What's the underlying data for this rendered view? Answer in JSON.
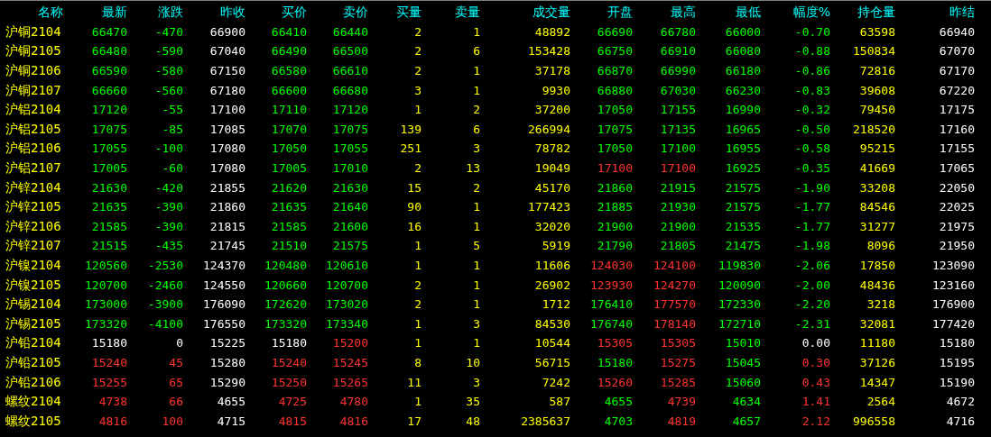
{
  "table": {
    "name_column": "名称",
    "columns": [
      "最新",
      "涨跌",
      "昨收",
      "买价",
      "卖价",
      "买量",
      "卖量",
      "成交量",
      "开盘",
      "最高",
      "最低",
      "幅度%",
      "持仓量",
      "昨结"
    ],
    "rows": [
      {
        "name": "沪铜2104",
        "cells": [
          {
            "text": "66470",
            "color": "#00ff00"
          },
          {
            "text": "-470",
            "color": "#00ff00"
          },
          {
            "text": "66900",
            "color": "#ffffff"
          },
          {
            "text": "66410",
            "color": "#00ff00"
          },
          {
            "text": "66440",
            "color": "#00ff00"
          },
          {
            "text": "2",
            "color": "#ffff00"
          },
          {
            "text": "1",
            "color": "#ffff00"
          },
          {
            "text": "48892",
            "color": "#ffff00"
          },
          {
            "text": "66690",
            "color": "#00ff00"
          },
          {
            "text": "66780",
            "color": "#00ff00"
          },
          {
            "text": "66000",
            "color": "#00ff00"
          },
          {
            "text": "-0.70",
            "color": "#00ff00"
          },
          {
            "text": "63598",
            "color": "#ffff00"
          },
          {
            "text": "66940",
            "color": "#ffffff"
          }
        ]
      },
      {
        "name": "沪铜2105",
        "cells": [
          {
            "text": "66480",
            "color": "#00ff00"
          },
          {
            "text": "-590",
            "color": "#00ff00"
          },
          {
            "text": "67040",
            "color": "#ffffff"
          },
          {
            "text": "66490",
            "color": "#00ff00"
          },
          {
            "text": "66500",
            "color": "#00ff00"
          },
          {
            "text": "2",
            "color": "#ffff00"
          },
          {
            "text": "6",
            "color": "#ffff00"
          },
          {
            "text": "153428",
            "color": "#ffff00"
          },
          {
            "text": "66750",
            "color": "#00ff00"
          },
          {
            "text": "66910",
            "color": "#00ff00"
          },
          {
            "text": "66080",
            "color": "#00ff00"
          },
          {
            "text": "-0.88",
            "color": "#00ff00"
          },
          {
            "text": "150834",
            "color": "#ffff00"
          },
          {
            "text": "67070",
            "color": "#ffffff"
          }
        ]
      },
      {
        "name": "沪铜2106",
        "cells": [
          {
            "text": "66590",
            "color": "#00ff00"
          },
          {
            "text": "-580",
            "color": "#00ff00"
          },
          {
            "text": "67150",
            "color": "#ffffff"
          },
          {
            "text": "66580",
            "color": "#00ff00"
          },
          {
            "text": "66610",
            "color": "#00ff00"
          },
          {
            "text": "2",
            "color": "#ffff00"
          },
          {
            "text": "1",
            "color": "#ffff00"
          },
          {
            "text": "37178",
            "color": "#ffff00"
          },
          {
            "text": "66870",
            "color": "#00ff00"
          },
          {
            "text": "66990",
            "color": "#00ff00"
          },
          {
            "text": "66180",
            "color": "#00ff00"
          },
          {
            "text": "-0.86",
            "color": "#00ff00"
          },
          {
            "text": "72816",
            "color": "#ffff00"
          },
          {
            "text": "67170",
            "color": "#ffffff"
          }
        ]
      },
      {
        "name": "沪铜2107",
        "cells": [
          {
            "text": "66660",
            "color": "#00ff00"
          },
          {
            "text": "-560",
            "color": "#00ff00"
          },
          {
            "text": "67180",
            "color": "#ffffff"
          },
          {
            "text": "66600",
            "color": "#00ff00"
          },
          {
            "text": "66680",
            "color": "#00ff00"
          },
          {
            "text": "3",
            "color": "#ffff00"
          },
          {
            "text": "1",
            "color": "#ffff00"
          },
          {
            "text": "9930",
            "color": "#ffff00"
          },
          {
            "text": "66880",
            "color": "#00ff00"
          },
          {
            "text": "67030",
            "color": "#00ff00"
          },
          {
            "text": "66230",
            "color": "#00ff00"
          },
          {
            "text": "-0.83",
            "color": "#00ff00"
          },
          {
            "text": "39608",
            "color": "#ffff00"
          },
          {
            "text": "67220",
            "color": "#ffffff"
          }
        ]
      },
      {
        "name": "沪铝2104",
        "cells": [
          {
            "text": "17120",
            "color": "#00ff00"
          },
          {
            "text": "-55",
            "color": "#00ff00"
          },
          {
            "text": "17100",
            "color": "#ffffff"
          },
          {
            "text": "17110",
            "color": "#00ff00"
          },
          {
            "text": "17120",
            "color": "#00ff00"
          },
          {
            "text": "1",
            "color": "#ffff00"
          },
          {
            "text": "2",
            "color": "#ffff00"
          },
          {
            "text": "37200",
            "color": "#ffff00"
          },
          {
            "text": "17050",
            "color": "#00ff00"
          },
          {
            "text": "17155",
            "color": "#00ff00"
          },
          {
            "text": "16990",
            "color": "#00ff00"
          },
          {
            "text": "-0.32",
            "color": "#00ff00"
          },
          {
            "text": "79450",
            "color": "#ffff00"
          },
          {
            "text": "17175",
            "color": "#ffffff"
          }
        ]
      },
      {
        "name": "沪铝2105",
        "cells": [
          {
            "text": "17075",
            "color": "#00ff00"
          },
          {
            "text": "-85",
            "color": "#00ff00"
          },
          {
            "text": "17085",
            "color": "#ffffff"
          },
          {
            "text": "17070",
            "color": "#00ff00"
          },
          {
            "text": "17075",
            "color": "#00ff00"
          },
          {
            "text": "139",
            "color": "#ffff00"
          },
          {
            "text": "6",
            "color": "#ffff00"
          },
          {
            "text": "266994",
            "color": "#ffff00"
          },
          {
            "text": "17075",
            "color": "#00ff00"
          },
          {
            "text": "17135",
            "color": "#00ff00"
          },
          {
            "text": "16965",
            "color": "#00ff00"
          },
          {
            "text": "-0.50",
            "color": "#00ff00"
          },
          {
            "text": "218520",
            "color": "#ffff00"
          },
          {
            "text": "17160",
            "color": "#ffffff"
          }
        ]
      },
      {
        "name": "沪铝2106",
        "cells": [
          {
            "text": "17055",
            "color": "#00ff00"
          },
          {
            "text": "-100",
            "color": "#00ff00"
          },
          {
            "text": "17080",
            "color": "#ffffff"
          },
          {
            "text": "17050",
            "color": "#00ff00"
          },
          {
            "text": "17055",
            "color": "#00ff00"
          },
          {
            "text": "251",
            "color": "#ffff00"
          },
          {
            "text": "3",
            "color": "#ffff00"
          },
          {
            "text": "78782",
            "color": "#ffff00"
          },
          {
            "text": "17050",
            "color": "#00ff00"
          },
          {
            "text": "17100",
            "color": "#00ff00"
          },
          {
            "text": "16955",
            "color": "#00ff00"
          },
          {
            "text": "-0.58",
            "color": "#00ff00"
          },
          {
            "text": "95215",
            "color": "#ffff00"
          },
          {
            "text": "17155",
            "color": "#ffffff"
          }
        ]
      },
      {
        "name": "沪铝2107",
        "cells": [
          {
            "text": "17005",
            "color": "#00ff00"
          },
          {
            "text": "-60",
            "color": "#00ff00"
          },
          {
            "text": "17080",
            "color": "#ffffff"
          },
          {
            "text": "17005",
            "color": "#00ff00"
          },
          {
            "text": "17010",
            "color": "#00ff00"
          },
          {
            "text": "2",
            "color": "#ffff00"
          },
          {
            "text": "13",
            "color": "#ffff00"
          },
          {
            "text": "19049",
            "color": "#ffff00"
          },
          {
            "text": "17100",
            "color": "#ff3232"
          },
          {
            "text": "17100",
            "color": "#ff3232"
          },
          {
            "text": "16925",
            "color": "#00ff00"
          },
          {
            "text": "-0.35",
            "color": "#00ff00"
          },
          {
            "text": "41669",
            "color": "#ffff00"
          },
          {
            "text": "17065",
            "color": "#ffffff"
          }
        ]
      },
      {
        "name": "沪锌2104",
        "cells": [
          {
            "text": "21630",
            "color": "#00ff00"
          },
          {
            "text": "-420",
            "color": "#00ff00"
          },
          {
            "text": "21855",
            "color": "#ffffff"
          },
          {
            "text": "21620",
            "color": "#00ff00"
          },
          {
            "text": "21630",
            "color": "#00ff00"
          },
          {
            "text": "15",
            "color": "#ffff00"
          },
          {
            "text": "2",
            "color": "#ffff00"
          },
          {
            "text": "45170",
            "color": "#ffff00"
          },
          {
            "text": "21860",
            "color": "#00ff00"
          },
          {
            "text": "21915",
            "color": "#00ff00"
          },
          {
            "text": "21575",
            "color": "#00ff00"
          },
          {
            "text": "-1.90",
            "color": "#00ff00"
          },
          {
            "text": "33208",
            "color": "#ffff00"
          },
          {
            "text": "22050",
            "color": "#ffffff"
          }
        ]
      },
      {
        "name": "沪锌2105",
        "cells": [
          {
            "text": "21635",
            "color": "#00ff00"
          },
          {
            "text": "-390",
            "color": "#00ff00"
          },
          {
            "text": "21860",
            "color": "#ffffff"
          },
          {
            "text": "21635",
            "color": "#00ff00"
          },
          {
            "text": "21640",
            "color": "#00ff00"
          },
          {
            "text": "90",
            "color": "#ffff00"
          },
          {
            "text": "1",
            "color": "#ffff00"
          },
          {
            "text": "177423",
            "color": "#ffff00"
          },
          {
            "text": "21885",
            "color": "#00ff00"
          },
          {
            "text": "21930",
            "color": "#00ff00"
          },
          {
            "text": "21575",
            "color": "#00ff00"
          },
          {
            "text": "-1.77",
            "color": "#00ff00"
          },
          {
            "text": "84546",
            "color": "#ffff00"
          },
          {
            "text": "22025",
            "color": "#ffffff"
          }
        ]
      },
      {
        "name": "沪锌2106",
        "cells": [
          {
            "text": "21585",
            "color": "#00ff00"
          },
          {
            "text": "-390",
            "color": "#00ff00"
          },
          {
            "text": "21815",
            "color": "#ffffff"
          },
          {
            "text": "21585",
            "color": "#00ff00"
          },
          {
            "text": "21600",
            "color": "#00ff00"
          },
          {
            "text": "16",
            "color": "#ffff00"
          },
          {
            "text": "1",
            "color": "#ffff00"
          },
          {
            "text": "32020",
            "color": "#ffff00"
          },
          {
            "text": "21900",
            "color": "#00ff00"
          },
          {
            "text": "21900",
            "color": "#00ff00"
          },
          {
            "text": "21535",
            "color": "#00ff00"
          },
          {
            "text": "-1.77",
            "color": "#00ff00"
          },
          {
            "text": "31277",
            "color": "#ffff00"
          },
          {
            "text": "21975",
            "color": "#ffffff"
          }
        ]
      },
      {
        "name": "沪锌2107",
        "cells": [
          {
            "text": "21515",
            "color": "#00ff00"
          },
          {
            "text": "-435",
            "color": "#00ff00"
          },
          {
            "text": "21745",
            "color": "#ffffff"
          },
          {
            "text": "21510",
            "color": "#00ff00"
          },
          {
            "text": "21575",
            "color": "#00ff00"
          },
          {
            "text": "1",
            "color": "#ffff00"
          },
          {
            "text": "5",
            "color": "#ffff00"
          },
          {
            "text": "5919",
            "color": "#ffff00"
          },
          {
            "text": "21790",
            "color": "#00ff00"
          },
          {
            "text": "21805",
            "color": "#00ff00"
          },
          {
            "text": "21475",
            "color": "#00ff00"
          },
          {
            "text": "-1.98",
            "color": "#00ff00"
          },
          {
            "text": "8096",
            "color": "#ffff00"
          },
          {
            "text": "21950",
            "color": "#ffffff"
          }
        ]
      },
      {
        "name": "沪镍2104",
        "cells": [
          {
            "text": "120560",
            "color": "#00ff00"
          },
          {
            "text": "-2530",
            "color": "#00ff00"
          },
          {
            "text": "124370",
            "color": "#ffffff"
          },
          {
            "text": "120480",
            "color": "#00ff00"
          },
          {
            "text": "120610",
            "color": "#00ff00"
          },
          {
            "text": "1",
            "color": "#ffff00"
          },
          {
            "text": "1",
            "color": "#ffff00"
          },
          {
            "text": "11606",
            "color": "#ffff00"
          },
          {
            "text": "124030",
            "color": "#ff3232"
          },
          {
            "text": "124100",
            "color": "#ff3232"
          },
          {
            "text": "119830",
            "color": "#00ff00"
          },
          {
            "text": "-2.06",
            "color": "#00ff00"
          },
          {
            "text": "17850",
            "color": "#ffff00"
          },
          {
            "text": "123090",
            "color": "#ffffff"
          }
        ]
      },
      {
        "name": "沪镍2105",
        "cells": [
          {
            "text": "120700",
            "color": "#00ff00"
          },
          {
            "text": "-2460",
            "color": "#00ff00"
          },
          {
            "text": "124550",
            "color": "#ffffff"
          },
          {
            "text": "120660",
            "color": "#00ff00"
          },
          {
            "text": "120700",
            "color": "#00ff00"
          },
          {
            "text": "2",
            "color": "#ffff00"
          },
          {
            "text": "1",
            "color": "#ffff00"
          },
          {
            "text": "26902",
            "color": "#ffff00"
          },
          {
            "text": "123930",
            "color": "#ff3232"
          },
          {
            "text": "124270",
            "color": "#ff3232"
          },
          {
            "text": "120090",
            "color": "#00ff00"
          },
          {
            "text": "-2.00",
            "color": "#00ff00"
          },
          {
            "text": "48436",
            "color": "#ffff00"
          },
          {
            "text": "123160",
            "color": "#ffffff"
          }
        ]
      },
      {
        "name": "沪锡2104",
        "cells": [
          {
            "text": "173000",
            "color": "#00ff00"
          },
          {
            "text": "-3900",
            "color": "#00ff00"
          },
          {
            "text": "176090",
            "color": "#ffffff"
          },
          {
            "text": "172620",
            "color": "#00ff00"
          },
          {
            "text": "173020",
            "color": "#00ff00"
          },
          {
            "text": "2",
            "color": "#ffff00"
          },
          {
            "text": "1",
            "color": "#ffff00"
          },
          {
            "text": "1712",
            "color": "#ffff00"
          },
          {
            "text": "176410",
            "color": "#00ff00"
          },
          {
            "text": "177570",
            "color": "#ff3232"
          },
          {
            "text": "172330",
            "color": "#00ff00"
          },
          {
            "text": "-2.20",
            "color": "#00ff00"
          },
          {
            "text": "3218",
            "color": "#ffff00"
          },
          {
            "text": "176900",
            "color": "#ffffff"
          }
        ]
      },
      {
        "name": "沪锡2105",
        "cells": [
          {
            "text": "173320",
            "color": "#00ff00"
          },
          {
            "text": "-4100",
            "color": "#00ff00"
          },
          {
            "text": "176550",
            "color": "#ffffff"
          },
          {
            "text": "173320",
            "color": "#00ff00"
          },
          {
            "text": "173340",
            "color": "#00ff00"
          },
          {
            "text": "1",
            "color": "#ffff00"
          },
          {
            "text": "3",
            "color": "#ffff00"
          },
          {
            "text": "84530",
            "color": "#ffff00"
          },
          {
            "text": "176740",
            "color": "#00ff00"
          },
          {
            "text": "178140",
            "color": "#ff3232"
          },
          {
            "text": "172710",
            "color": "#00ff00"
          },
          {
            "text": "-2.31",
            "color": "#00ff00"
          },
          {
            "text": "32081",
            "color": "#ffff00"
          },
          {
            "text": "177420",
            "color": "#ffffff"
          }
        ]
      },
      {
        "name": "沪铅2104",
        "cells": [
          {
            "text": "15180",
            "color": "#ffffff"
          },
          {
            "text": "0",
            "color": "#ffffff"
          },
          {
            "text": "15225",
            "color": "#ffffff"
          },
          {
            "text": "15180",
            "color": "#ffffff"
          },
          {
            "text": "15200",
            "color": "#ff3232"
          },
          {
            "text": "1",
            "color": "#ffff00"
          },
          {
            "text": "1",
            "color": "#ffff00"
          },
          {
            "text": "10544",
            "color": "#ffff00"
          },
          {
            "text": "15305",
            "color": "#ff3232"
          },
          {
            "text": "15305",
            "color": "#ff3232"
          },
          {
            "text": "15010",
            "color": "#00ff00"
          },
          {
            "text": "0.00",
            "color": "#ffffff"
          },
          {
            "text": "11180",
            "color": "#ffff00"
          },
          {
            "text": "15180",
            "color": "#ffffff"
          }
        ]
      },
      {
        "name": "沪铅2105",
        "cells": [
          {
            "text": "15240",
            "color": "#ff3232"
          },
          {
            "text": "45",
            "color": "#ff3232"
          },
          {
            "text": "15280",
            "color": "#ffffff"
          },
          {
            "text": "15240",
            "color": "#ff3232"
          },
          {
            "text": "15245",
            "color": "#ff3232"
          },
          {
            "text": "8",
            "color": "#ffff00"
          },
          {
            "text": "10",
            "color": "#ffff00"
          },
          {
            "text": "56715",
            "color": "#ffff00"
          },
          {
            "text": "15180",
            "color": "#00ff00"
          },
          {
            "text": "15275",
            "color": "#ff3232"
          },
          {
            "text": "15045",
            "color": "#00ff00"
          },
          {
            "text": "0.30",
            "color": "#ff3232"
          },
          {
            "text": "37126",
            "color": "#ffff00"
          },
          {
            "text": "15195",
            "color": "#ffffff"
          }
        ]
      },
      {
        "name": "沪铅2106",
        "cells": [
          {
            "text": "15255",
            "color": "#ff3232"
          },
          {
            "text": "65",
            "color": "#ff3232"
          },
          {
            "text": "15290",
            "color": "#ffffff"
          },
          {
            "text": "15250",
            "color": "#ff3232"
          },
          {
            "text": "15265",
            "color": "#ff3232"
          },
          {
            "text": "11",
            "color": "#ffff00"
          },
          {
            "text": "3",
            "color": "#ffff00"
          },
          {
            "text": "7242",
            "color": "#ffff00"
          },
          {
            "text": "15260",
            "color": "#ff3232"
          },
          {
            "text": "15285",
            "color": "#ff3232"
          },
          {
            "text": "15060",
            "color": "#00ff00"
          },
          {
            "text": "0.43",
            "color": "#ff3232"
          },
          {
            "text": "14347",
            "color": "#ffff00"
          },
          {
            "text": "15190",
            "color": "#ffffff"
          }
        ]
      },
      {
        "name": "螺纹2104",
        "cells": [
          {
            "text": "4738",
            "color": "#ff3232"
          },
          {
            "text": "66",
            "color": "#ff3232"
          },
          {
            "text": "4655",
            "color": "#ffffff"
          },
          {
            "text": "4725",
            "color": "#ff3232"
          },
          {
            "text": "4780",
            "color": "#ff3232"
          },
          {
            "text": "1",
            "color": "#ffff00"
          },
          {
            "text": "35",
            "color": "#ffff00"
          },
          {
            "text": "587",
            "color": "#ffff00"
          },
          {
            "text": "4655",
            "color": "#00ff00"
          },
          {
            "text": "4739",
            "color": "#ff3232"
          },
          {
            "text": "4634",
            "color": "#00ff00"
          },
          {
            "text": "1.41",
            "color": "#ff3232"
          },
          {
            "text": "2564",
            "color": "#ffff00"
          },
          {
            "text": "4672",
            "color": "#ffffff"
          }
        ]
      },
      {
        "name": "螺纹2105",
        "cells": [
          {
            "text": "4816",
            "color": "#ff3232"
          },
          {
            "text": "100",
            "color": "#ff3232"
          },
          {
            "text": "4715",
            "color": "#ffffff"
          },
          {
            "text": "4815",
            "color": "#ff3232"
          },
          {
            "text": "4816",
            "color": "#ff3232"
          },
          {
            "text": "17",
            "color": "#ffff00"
          },
          {
            "text": "48",
            "color": "#ffff00"
          },
          {
            "text": "2385637",
            "color": "#ffff00"
          },
          {
            "text": "4703",
            "color": "#00ff00"
          },
          {
            "text": "4819",
            "color": "#ff3232"
          },
          {
            "text": "4657",
            "color": "#00ff00"
          },
          {
            "text": "2.12",
            "color": "#ff3232"
          },
          {
            "text": "996558",
            "color": "#ffff00"
          },
          {
            "text": "4716",
            "color": "#ffffff"
          }
        ]
      }
    ]
  }
}
